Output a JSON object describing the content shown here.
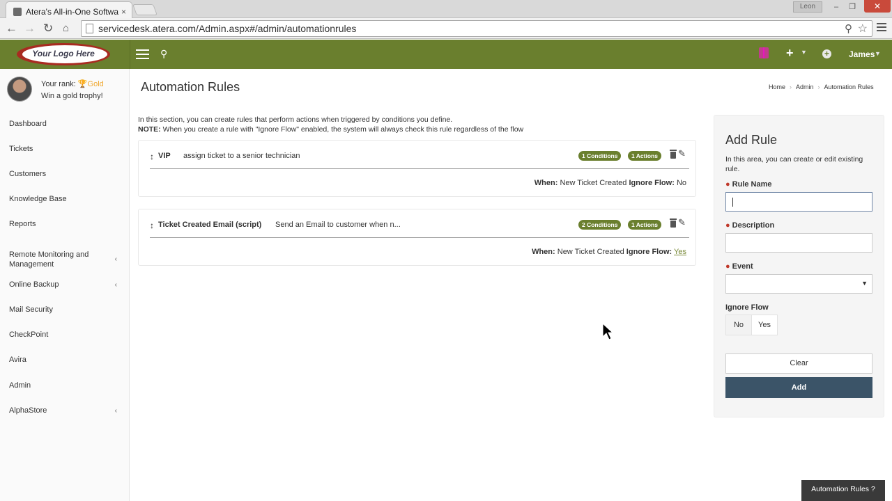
{
  "browser": {
    "tab_title": "Atera's All-in-One Softwa",
    "tab_close": "×",
    "window_user": "Leon",
    "url": "servicedesk.atera.com/Admin.aspx#/admin/automationrules"
  },
  "header": {
    "logo_text": "Your Logo Here",
    "user_name": "James"
  },
  "sidebar": {
    "rank_label": "Your rank:",
    "rank_value": "Gold",
    "trophy_text": "Win a gold trophy!",
    "items": [
      {
        "label": "Dashboard",
        "has_arrow": false
      },
      {
        "label": "Tickets",
        "has_arrow": false
      },
      {
        "label": "Customers",
        "has_arrow": false
      },
      {
        "label": "Knowledge Base",
        "has_arrow": false
      },
      {
        "label": "Reports",
        "has_arrow": false
      },
      {
        "label": "Remote Monitoring and Management",
        "has_arrow": true
      },
      {
        "label": "Online Backup",
        "has_arrow": true
      },
      {
        "label": "Mail Security",
        "has_arrow": false
      },
      {
        "label": "CheckPoint",
        "has_arrow": false
      },
      {
        "label": "Avira",
        "has_arrow": false
      },
      {
        "label": "Admin",
        "has_arrow": false
      },
      {
        "label": "AlphaStore",
        "has_arrow": true
      }
    ]
  },
  "page": {
    "title": "Automation Rules",
    "breadcrumb": [
      "Home",
      "Admin",
      "Automation Rules"
    ],
    "intro_line1": "In this section, you can create rules that perform actions when triggered by conditions you define.",
    "intro_note_label": "NOTE:",
    "intro_note_text": "When you create a rule with \"Ignore Flow\" enabled, the system will always check this rule regardless of the flow"
  },
  "rules": [
    {
      "name": "VIP",
      "description": "assign ticket to a senior technician",
      "conditions": "1 Conditions",
      "actions": "1 Actions",
      "when_label": "When:",
      "when_value": "New Ticket Created",
      "ignore_label": "Ignore Flow:",
      "ignore_value": "No"
    },
    {
      "name": "Ticket Created Email (script)",
      "description": "Send an Email to customer when n...",
      "conditions": "2 Conditions",
      "actions": "1 Actions",
      "when_label": "When:",
      "when_value": "New Ticket Created",
      "ignore_label": "Ignore Flow:",
      "ignore_value": "Yes"
    }
  ],
  "add_rule": {
    "title": "Add Rule",
    "help": "In this area, you can create or edit existing rule.",
    "rule_name_label": "Rule Name",
    "rule_name_value": "",
    "description_label": "Description",
    "event_label": "Event",
    "ignore_flow_label": "Ignore Flow",
    "ignore_no": "No",
    "ignore_yes": "Yes",
    "clear_button": "Clear",
    "add_button": "Add"
  },
  "footer": {
    "help_tab": "Automation Rules ?"
  },
  "colors": {
    "brand_green": "#6a7f2e",
    "add_button": "#3b5468",
    "required_marker": "#c0392b"
  }
}
